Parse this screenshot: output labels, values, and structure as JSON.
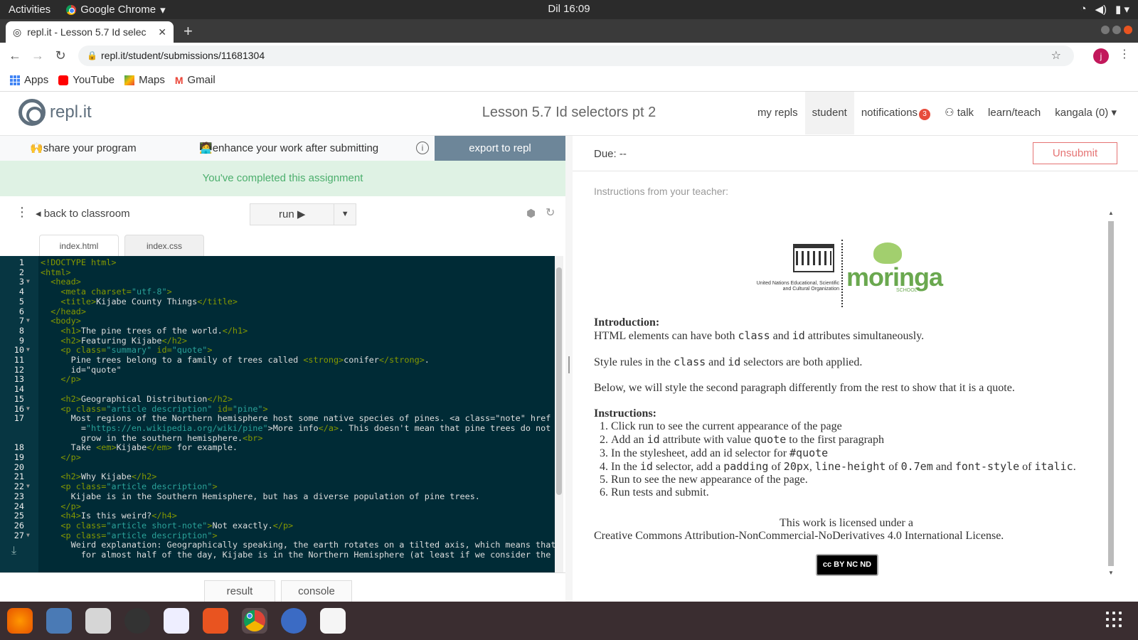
{
  "system": {
    "activities": "Activities",
    "app_name": "Google Chrome",
    "clock": "Dil 16:09"
  },
  "browser": {
    "tab_title": "repl.it - Lesson 5.7 Id selec",
    "url": "repl.it/student/submissions/11681304",
    "avatar_letter": "j",
    "bookmarks": [
      "Apps",
      "YouTube",
      "Maps",
      "Gmail"
    ]
  },
  "header": {
    "logo_text": "repl.it",
    "page_title": "Lesson 5.7 Id selectors pt 2",
    "nav": [
      "my repls",
      "student",
      "notifications",
      "talk",
      "learn/teach",
      "kangala (0)"
    ],
    "notification_count": "3"
  },
  "left": {
    "share": "share your program",
    "enhance": "enhance your work after submitting",
    "export": "export to repl",
    "completed": "You've completed this assignment",
    "back": "back to classroom",
    "run": "run",
    "files": [
      "index.html",
      "index.css"
    ],
    "bottom_tabs": [
      "result",
      "console"
    ]
  },
  "code_lines": [
    {
      "n": "1",
      "t": "<!DOCTYPE html>"
    },
    {
      "n": "2",
      "t": "<html>"
    },
    {
      "n": "3",
      "t": "  <head>"
    },
    {
      "n": "4",
      "t": "    <meta charset=\"utf-8\">"
    },
    {
      "n": "5",
      "t": "    <title>Kijabe County Things</title>"
    },
    {
      "n": "6",
      "t": "  </head>"
    },
    {
      "n": "7",
      "t": "  <body>"
    },
    {
      "n": "8",
      "t": "    <h1>The pine trees of the world.</h1>"
    },
    {
      "n": "9",
      "t": "    <h2>Featuring Kijabe</h2>"
    },
    {
      "n": "10",
      "t": "    <p class=\"summary\" id=\"quote\">"
    },
    {
      "n": "11",
      "t": "      Pine trees belong to a family of trees called <strong>conifer</strong>."
    },
    {
      "n": "12",
      "t": "      id=\"quote\""
    },
    {
      "n": "13",
      "t": "    </p>"
    },
    {
      "n": "14",
      "t": ""
    },
    {
      "n": "15",
      "t": "    <h2>Geographical Distribution</h2>"
    },
    {
      "n": "16",
      "t": "    <p class=\"article description\" id=\"pine\">"
    },
    {
      "n": "17",
      "t": "      Most regions of the Northern hemisphere host some native species of pines. <a class=\"note\" href"
    },
    {
      "n": "",
      "t": "        =\"https://en.wikipedia.org/wiki/pine\">More info</a>. This doesn't mean that pine trees do not"
    },
    {
      "n": "",
      "t": "        grow in the southern hemisphere.<br>"
    },
    {
      "n": "18",
      "t": "      Take <em>Kijabe</em> for example."
    },
    {
      "n": "19",
      "t": "    </p>"
    },
    {
      "n": "20",
      "t": ""
    },
    {
      "n": "21",
      "t": "    <h2>Why Kijabe</h2>"
    },
    {
      "n": "22",
      "t": "    <p class=\"article description\">"
    },
    {
      "n": "23",
      "t": "      Kijabe is in the Southern Hemisphere, but has a diverse population of pine trees."
    },
    {
      "n": "24",
      "t": "    </p>"
    },
    {
      "n": "25",
      "t": "    <h4>Is this weird?</h4>"
    },
    {
      "n": "26",
      "t": "    <p class=\"article short-note\">Not exactly.</p>"
    },
    {
      "n": "27",
      "t": "    <p class=\"article description\">"
    },
    {
      "n": "",
      "t": "      Weird explanation: Geographically speaking, the earth rotates on a tilted axis, which means that"
    },
    {
      "n": "",
      "t": "        for almost half of the day, Kijabe is in the Northern Hemisphere (at least if we consider the"
    }
  ],
  "fold_lines": [
    "3",
    "7",
    "10",
    "16",
    "22",
    "27"
  ],
  "right": {
    "due": "Due: --",
    "unsubmit": "Unsubmit",
    "instructions_label": "Instructions from your teacher:",
    "unesco_text": "United Nations Educational, Scientific and Cultural Organization",
    "moringa": "moringa",
    "moringa_sub": "SCHOOL",
    "intro_heading": "Introduction:",
    "instructions_heading": "Instructions:",
    "license_1": "This work is licensed under a",
    "license_2": "Creative Commons Attribution-NonCommercial-NoDerivatives 4.0 International License.",
    "cc_badge": "cc BY NC ND"
  },
  "colors": {
    "export": "#6d8699",
    "completed_bg": "#dff2e4",
    "completed_text": "#4caf6d",
    "editor_bg": "#002b36",
    "unsubmit": "#e57373"
  }
}
